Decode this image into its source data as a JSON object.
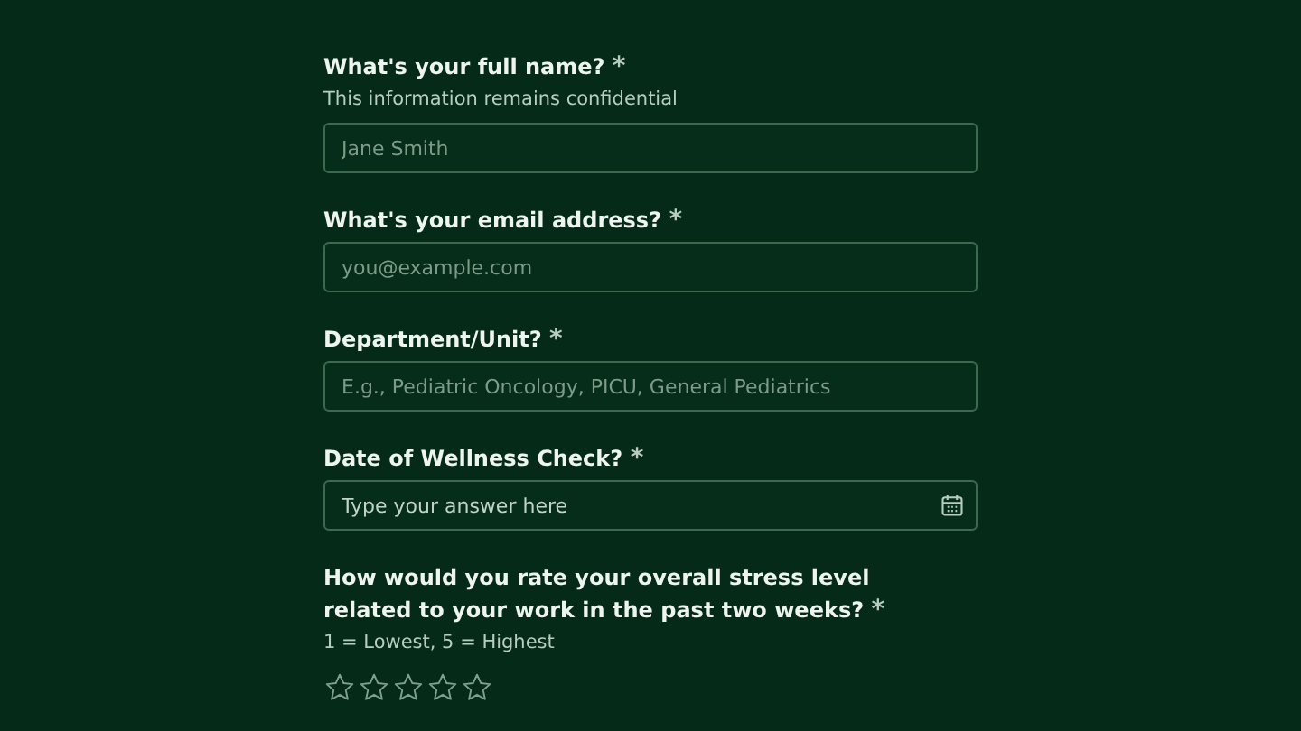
{
  "questions": [
    {
      "kind": "text",
      "label": "What's your full name?",
      "required_mark": "*",
      "hint": "This information remains confidential",
      "placeholder": "Jane Smith"
    },
    {
      "kind": "text",
      "label": "What's your email address?",
      "required_mark": "*",
      "placeholder": "you@example.com"
    },
    {
      "kind": "text",
      "label": "Department/Unit?",
      "required_mark": "*",
      "placeholder": "E.g., Pediatric Oncology, PICU, General Pediatrics"
    },
    {
      "kind": "date",
      "label": "Date of Wellness Check?",
      "required_mark": "*",
      "placeholder": "Type your answer here"
    },
    {
      "kind": "rating",
      "label": "How would you rate your overall stress level related to your work in the past two weeks?",
      "required_mark": "*",
      "hint": "1 = Lowest, 5 = Highest",
      "stars": 0
    }
  ]
}
